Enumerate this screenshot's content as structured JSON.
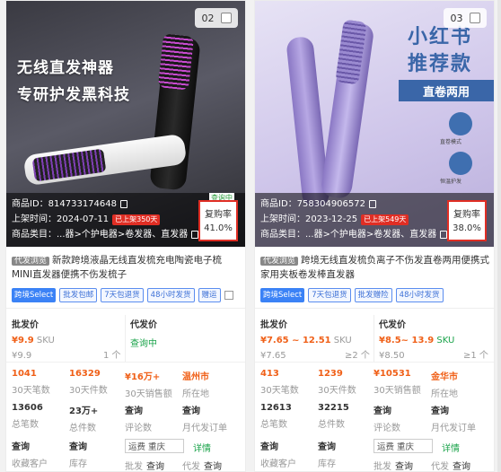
{
  "cards": [
    {
      "index": "02",
      "image_headline_1": "无线直发神器",
      "image_headline_2": "专研护发黑科技",
      "product_id": "商品ID：814733174648",
      "listed_time": "上架时间：2024-07-11",
      "listed_badge": "已上架350天",
      "category": "商品类目：...器>个护电器>卷发器、直发器",
      "status_chip": "查询中",
      "repurchase_label": "复购率",
      "repurchase_value": "41.0%",
      "title_badge": "代发浏览",
      "title": "新款跨境液晶无线直发梳充电陶瓷电子梳MINI直发器便携不伤发梳子",
      "tags": [
        "跨境Select",
        "批发包邮",
        "7天包退货",
        "48小时发货",
        "赠运"
      ],
      "wholesale_label": "批发价",
      "wholesale_price": "¥9.9",
      "wholesale_sku": "SKU",
      "wholesale_sub": "¥9.9",
      "wholesale_min": "1 个",
      "dropship_label": "代发价",
      "dropship_value": "查询中",
      "stats_row1": [
        {
          "value": "1041",
          "caption": "30天笔数"
        },
        {
          "value": "16329",
          "caption": "30天件数"
        },
        {
          "value": "¥16万+",
          "caption": "30天销售额"
        },
        {
          "value": "温州市",
          "caption": "所在地"
        }
      ],
      "stats_row2": [
        {
          "value": "13606",
          "caption": "总笔数"
        },
        {
          "value": "23万+",
          "caption": "总件数"
        },
        {
          "value": "查询",
          "caption": "评论数"
        },
        {
          "value": "查询",
          "caption": "月代发订单"
        }
      ],
      "stats_row3": [
        {
          "value": "查询",
          "caption": "收藏客户"
        },
        {
          "value": "查询",
          "caption": "库存"
        }
      ],
      "ship_label": "运费",
      "ship_city": "重庆",
      "ship_detail": "详情",
      "pifa_label": "批发",
      "pifa_value": "查询",
      "daifa_label": "代发",
      "daifa_value": "查询"
    },
    {
      "index": "03",
      "image_headline_1": "小红书",
      "image_headline_2": "推荐款",
      "image_banner": "直卷两用",
      "image_feature_1": "直卷模式",
      "image_feature_2": "恒温护发",
      "product_id": "商品ID：758304906572",
      "listed_time": "上架时间：2023-12-25",
      "listed_badge": "已上架549天",
      "category": "商品类目：...器>个护电器>卷发器、直发器",
      "repurchase_label": "复购率",
      "repurchase_value": "38.0%",
      "title_badge": "代发浏览",
      "title": "跨境无线直发梳负离子不伤发直卷两用便携式家用夹板卷发棒直发器",
      "tags": [
        "跨境Select",
        "7天包退货",
        "批发赠险",
        "48小时发货"
      ],
      "wholesale_label": "批发价",
      "wholesale_price": "¥7.65 ~ 12.51",
      "wholesale_sku": "SKU",
      "wholesale_sub": "¥7.65",
      "wholesale_min": "≥2 个",
      "dropship_label": "代发价",
      "dropship_value": "¥8.5~ 13.9",
      "dropship_sku": "SKU",
      "dropship_sub": "¥8.50",
      "dropship_min": "≥1 个",
      "stats_row1": [
        {
          "value": "413",
          "caption": "30天笔数"
        },
        {
          "value": "1239",
          "caption": "30天件数"
        },
        {
          "value": "¥10531",
          "caption": "30天销售额"
        },
        {
          "value": "金华市",
          "caption": "所在地"
        }
      ],
      "stats_row2": [
        {
          "value": "12613",
          "caption": "总笔数"
        },
        {
          "value": "32215",
          "caption": "总件数"
        },
        {
          "value": "查询",
          "caption": "评论数"
        },
        {
          "value": "查询",
          "caption": "月代发订单"
        }
      ],
      "stats_row3": [
        {
          "value": "查询",
          "caption": "收藏客户"
        },
        {
          "value": "查询",
          "caption": "库存"
        }
      ],
      "ship_label": "运费",
      "ship_city": "重庆",
      "ship_detail": "详情",
      "pifa_label": "批发",
      "pifa_value": "查询",
      "daifa_label": "代发",
      "daifa_value": "查询"
    }
  ],
  "colors": {
    "accent_red": "#e02e24",
    "price_orange": "#f06018",
    "green": "#1aa34a",
    "tag_blue": "#3b82f6"
  },
  "icons": [
    "copy-icon",
    "checkbox-icon",
    "stats-icon"
  ]
}
